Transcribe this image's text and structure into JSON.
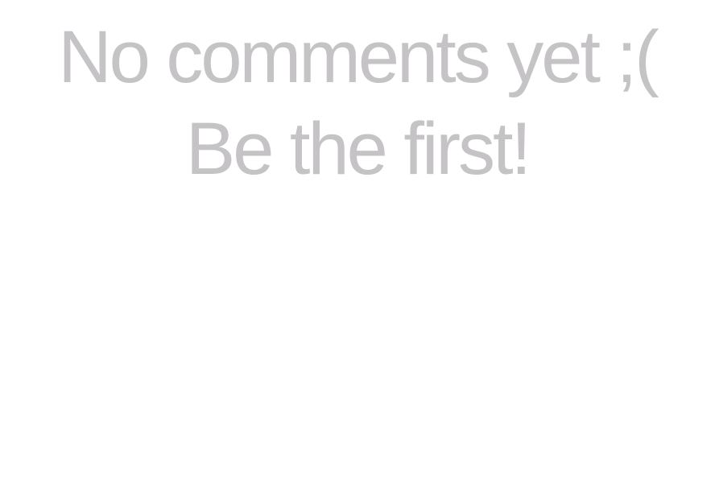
{
  "empty_state": {
    "line1": "No comments yet ;(",
    "line2": "Be the first!"
  },
  "colors": {
    "text": "#c5c3c6",
    "background": "#ffffff"
  }
}
